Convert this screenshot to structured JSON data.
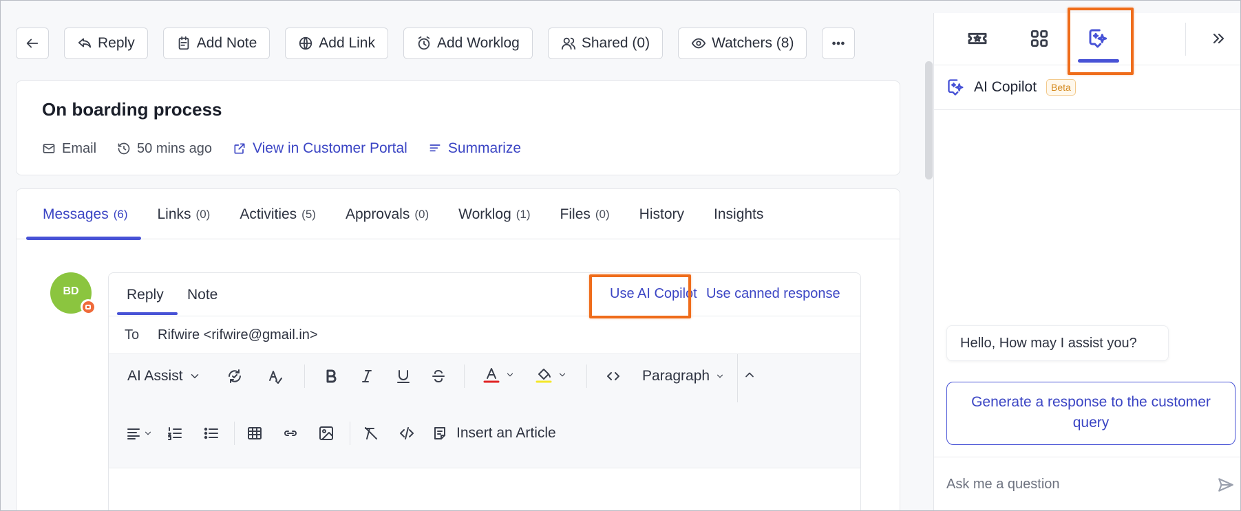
{
  "toolbar": {
    "reply": "Reply",
    "add_note": "Add Note",
    "add_link": "Add Link",
    "add_worklog": "Add Worklog",
    "shared": "Shared (0)",
    "watchers": "Watchers (8)"
  },
  "ticket": {
    "title": "On boarding process",
    "channel": "Email",
    "time_ago": "50 mins ago",
    "portal_link": "View in Customer Portal",
    "summarize": "Summarize"
  },
  "tabs": [
    {
      "label": "Messages",
      "count": "(6)"
    },
    {
      "label": "Links",
      "count": "(0)"
    },
    {
      "label": "Activities",
      "count": "(5)"
    },
    {
      "label": "Approvals",
      "count": "(0)"
    },
    {
      "label": "Worklog",
      "count": "(1)"
    },
    {
      "label": "Files",
      "count": "(0)"
    },
    {
      "label": "History",
      "count": ""
    },
    {
      "label": "Insights",
      "count": ""
    }
  ],
  "avatar": {
    "initials": "BD",
    "color": "#8bc53f"
  },
  "composer": {
    "reply_tab": "Reply",
    "note_tab": "Note",
    "use_ai_copilot": "Use AI Copilot",
    "use_canned": "Use canned response",
    "to_label": "To",
    "to_value": "Rifwire <rifwire@gmail.in>",
    "ai_assist": "AI Assist",
    "block_format": "Paragraph",
    "insert_article": "Insert an Article",
    "text_color": "#e02424",
    "highlight_color": "#f4e72a"
  },
  "copilot": {
    "title": "AI Copilot",
    "badge": "Beta",
    "greeting": "Hello, How may I assist you?",
    "suggestion": "Generate a response to the customer query",
    "input_placeholder": "Ask me a question"
  },
  "colors": {
    "accent": "#4752d6",
    "highlight_box": "#ef6c1a"
  }
}
